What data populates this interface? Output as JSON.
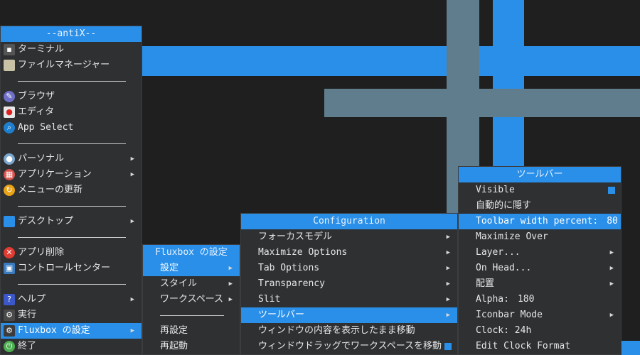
{
  "main_menu": {
    "title": "--antiX--",
    "items": [
      {
        "label": "ターミナル"
      },
      {
        "label": "ファイルマネージャー"
      },
      {
        "label": "ブラウザ"
      },
      {
        "label": "エディタ"
      },
      {
        "label": "App Select"
      },
      {
        "label": "パーソナル"
      },
      {
        "label": "アプリケーション"
      },
      {
        "label": "メニューの更新"
      },
      {
        "label": "デスクトップ"
      },
      {
        "label": "アプリ削除"
      },
      {
        "label": "コントロールセンター"
      },
      {
        "label": "ヘルプ"
      },
      {
        "label": "実行"
      },
      {
        "label": "Fluxbox の設定"
      },
      {
        "label": "終了"
      }
    ]
  },
  "fluxbox_menu": {
    "title": "Fluxbox の設定",
    "items": [
      {
        "label": "設定"
      },
      {
        "label": "スタイル"
      },
      {
        "label": "ワークスペース"
      },
      {
        "label": "再設定"
      },
      {
        "label": "再起動"
      }
    ]
  },
  "config_menu": {
    "title": "Configuration",
    "items": [
      {
        "label": "フォーカスモデル"
      },
      {
        "label": "Maximize Options"
      },
      {
        "label": "Tab Options"
      },
      {
        "label": "Transparency"
      },
      {
        "label": "Slit"
      },
      {
        "label": "ツールバー"
      },
      {
        "label": "ウィンドウの内容を表示したまま移動"
      },
      {
        "label": "ウィンドウドラッグでワークスペースを移動"
      }
    ]
  },
  "toolbar_menu": {
    "title": "ツールバー",
    "items": [
      {
        "label": "Visible"
      },
      {
        "label": "自動的に隠す"
      },
      {
        "label": "Toolbar width percent:",
        "value": "80"
      },
      {
        "label": "Maximize Over"
      },
      {
        "label": "Layer..."
      },
      {
        "label": "On Head..."
      },
      {
        "label": "配置"
      },
      {
        "label": "Alpha:",
        "value": "180"
      },
      {
        "label": "Iconbar Mode"
      },
      {
        "label": "Clock: 24h"
      },
      {
        "label": "Edit Clock Format"
      }
    ]
  },
  "colors": {
    "accent": "#2a8fe8",
    "menu_bg": "#2f3032",
    "desktop": "#1f1f1f",
    "steel": "#5f7d8c"
  }
}
